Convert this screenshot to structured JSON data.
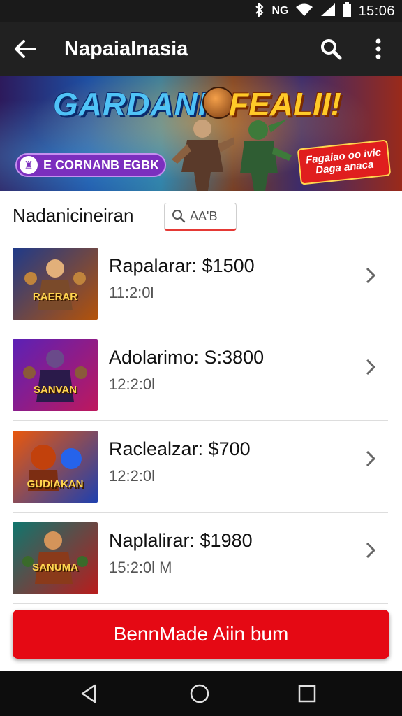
{
  "status_bar": {
    "time": "15:06",
    "network": "NG"
  },
  "app_bar": {
    "title": "Napaialnasia",
    "back_icon": "arrow-left-icon",
    "search_icon": "search-icon",
    "more_icon": "more-vert-icon"
  },
  "banner": {
    "title_left": "GARDANI",
    "title_right": "FEALII!",
    "promo_label": "E CORNANB EGBK",
    "badge_text": "Fagaiao oo ivic Daga anaca"
  },
  "section": {
    "title": "Nadanicineiran",
    "search_chip_label": "AA'B"
  },
  "list": {
    "items": [
      {
        "title": "Rapalarar: $1500",
        "time": "11:2:0l",
        "thumb_label": "RAERAR",
        "colors": [
          "#1e3a8a",
          "#b45309"
        ]
      },
      {
        "title": "Adolarimo: S:3800",
        "time": "12:2:0l",
        "thumb_label": "SANVAN",
        "colors": [
          "#5b21b6",
          "#be185d"
        ]
      },
      {
        "title": "Raclealzar: $700",
        "time": "12:2:0l",
        "thumb_label": "GUDIAKAN",
        "colors": [
          "#ea580c",
          "#1e40af"
        ]
      },
      {
        "title": "Naplalirar: $1980",
        "time": "15:2:0l M",
        "thumb_label": "SANUMA",
        "colors": [
          "#0f766e",
          "#b91c1c"
        ]
      }
    ]
  },
  "cta": {
    "label": "BennMade Aiin bum"
  },
  "colors": {
    "accent": "#e50914",
    "app_bar": "#212121"
  }
}
